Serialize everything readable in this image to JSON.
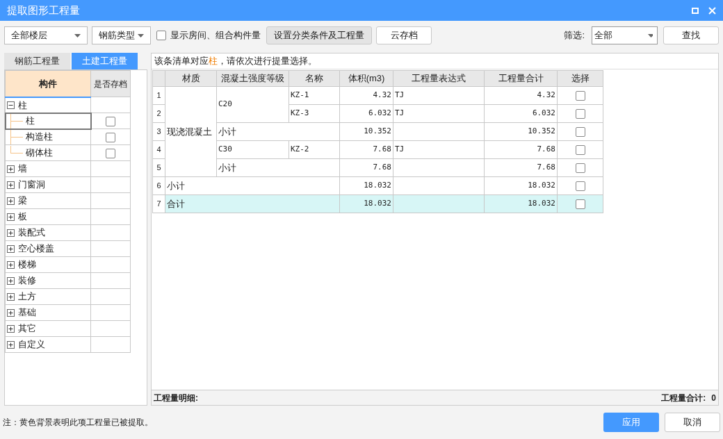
{
  "window": {
    "title": "提取图形工程量"
  },
  "toolbar": {
    "floor_select": "全部楼层",
    "rebar_select": "钢筋类型",
    "show_rooms": {
      "label": "显示房间、组合构件量",
      "checked": false
    },
    "buttons": [
      "设置分类条件及工程量",
      "云存档"
    ],
    "filter_label": "筛选:",
    "filter_select": "全部",
    "find_button": "查找"
  },
  "tabs": [
    {
      "label": "钢筋工程量",
      "selected": false
    },
    {
      "label": "土建工程量",
      "selected": true
    }
  ],
  "tree": {
    "columns": [
      "构件",
      "是否存档"
    ],
    "items": [
      {
        "label": "柱",
        "expanded": true,
        "children": [
          {
            "label": "柱",
            "selected": true,
            "checked": false
          },
          {
            "label": "构造柱",
            "selected": false,
            "checked": false
          },
          {
            "label": "砌体柱",
            "selected": false,
            "checked": false
          }
        ]
      },
      {
        "label": "墙",
        "expanded": false
      },
      {
        "label": "门窗洞",
        "expanded": false
      },
      {
        "label": "梁",
        "expanded": false
      },
      {
        "label": "板",
        "expanded": false
      },
      {
        "label": "装配式",
        "expanded": false
      },
      {
        "label": "空心楼盖",
        "expanded": false
      },
      {
        "label": "楼梯",
        "expanded": false
      },
      {
        "label": "装修",
        "expanded": false
      },
      {
        "label": "土方",
        "expanded": false
      },
      {
        "label": "基础",
        "expanded": false
      },
      {
        "label": "其它",
        "expanded": false
      },
      {
        "label": "自定义",
        "expanded": false
      }
    ]
  },
  "notice": {
    "before": "该条清单对应",
    "highlight": "柱",
    "after": "，请依次进行提量选择。"
  },
  "table": {
    "columns": [
      "材质",
      "混凝土强度等级",
      "名称",
      "体积(m3)",
      "工程量表达式",
      "工程量合计",
      "选择"
    ],
    "rows": [
      {
        "no": "1",
        "highlighted": false,
        "checked": false,
        "cells": [
          {
            "kind": "text",
            "text": "现浇混凝土",
            "rowspan": 5
          },
          {
            "kind": "text",
            "text": "C20",
            "rowspan": 2
          },
          {
            "kind": "text",
            "text": "KZ-1"
          },
          {
            "kind": "number",
            "text": "4.32"
          },
          {
            "kind": "text",
            "text": "TJ"
          },
          {
            "kind": "number",
            "text": "4.32"
          }
        ]
      },
      {
        "no": "2",
        "highlighted": false,
        "checked": false,
        "cells": [
          {
            "kind": "text",
            "text": "KZ-3"
          },
          {
            "kind": "number",
            "text": "6.032"
          },
          {
            "kind": "text",
            "text": "TJ"
          },
          {
            "kind": "number",
            "text": "6.032"
          }
        ]
      },
      {
        "no": "3",
        "highlighted": false,
        "checked": false,
        "cells": [
          {
            "kind": "text",
            "text": "小计",
            "colspan": 2
          },
          {
            "kind": "number",
            "text": "10.352"
          },
          {
            "kind": "blank"
          },
          {
            "kind": "number",
            "text": "10.352"
          }
        ]
      },
      {
        "no": "4",
        "highlighted": false,
        "checked": false,
        "cells": [
          {
            "kind": "text",
            "text": "C30"
          },
          {
            "kind": "text",
            "text": "KZ-2"
          },
          {
            "kind": "number",
            "text": "7.68"
          },
          {
            "kind": "text",
            "text": "TJ"
          },
          {
            "kind": "number",
            "text": "7.68"
          }
        ]
      },
      {
        "no": "5",
        "highlighted": false,
        "checked": false,
        "cells": [
          {
            "kind": "text",
            "text": "小计",
            "colspan": 2
          },
          {
            "kind": "number",
            "text": "7.68"
          },
          {
            "kind": "blank"
          },
          {
            "kind": "number",
            "text": "7.68"
          }
        ]
      },
      {
        "no": "6",
        "highlighted": false,
        "checked": false,
        "cells": [
          {
            "kind": "text",
            "text": "小计",
            "colspan": 3
          },
          {
            "kind": "number",
            "text": "18.032"
          },
          {
            "kind": "blank"
          },
          {
            "kind": "number",
            "text": "18.032"
          }
        ]
      },
      {
        "no": "7",
        "highlighted": true,
        "checked": false,
        "cells": [
          {
            "kind": "text",
            "text": "合计",
            "colspan": 3
          },
          {
            "kind": "number",
            "text": "18.032"
          },
          {
            "kind": "blank"
          },
          {
            "kind": "number",
            "text": "18.032"
          }
        ]
      }
    ]
  },
  "detail_bar": {
    "left": "工程量明细:",
    "right_label": "工程量合计:",
    "right_value": "0"
  },
  "footer": {
    "note": "注：黄色背景表明此项工程量已被提取。",
    "buttons": [
      {
        "label": "应用",
        "primary": true
      },
      {
        "label": "取消",
        "primary": false
      }
    ]
  }
}
